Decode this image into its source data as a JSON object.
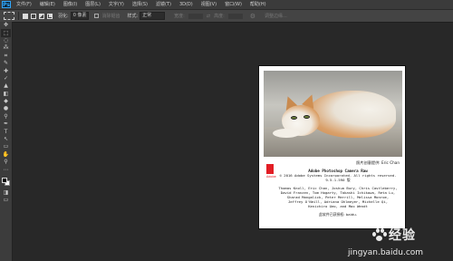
{
  "app": {
    "logo": "Ps"
  },
  "menu": [
    "文件(F)",
    "编辑(E)",
    "图像(I)",
    "图层(L)",
    "文字(Y)",
    "选择(S)",
    "滤镜(T)",
    "3D(D)",
    "视图(V)",
    "窗口(W)",
    "帮助(H)"
  ],
  "options": {
    "feather_label": "羽化:",
    "feather_value": "0 像素",
    "antialias_label": "消除锯齿",
    "style_label": "样式:",
    "style_value": "正常",
    "width_label": "宽度:",
    "height_label": "高度:",
    "refine_edge": "调整边缘..."
  },
  "tools": [
    "✥",
    "⬚",
    "◌",
    "⁂",
    "⌗",
    "✎",
    "✚",
    "✓",
    "▲",
    "◧",
    "◆",
    "●",
    "⚲",
    "✒",
    "T",
    "↖",
    "▭",
    "✋",
    "⚲",
    "⋯"
  ],
  "about": {
    "credit": "照片创意提供: Eric Chan",
    "adobe": "Adobe",
    "product": "Adobe Photoshop Camera Raw",
    "copyright": "© 2016 Adobe Systems Incorporated. All rights reserved.",
    "version": "9.5.1.590 版",
    "credits_lines": [
      "Thomas Knoll, Eric Chan, Joshua Bury, Chris Castleberry,",
      "David Franzen, Tom Hogarty, Takashi Ichikawa, Reta Lu,",
      "Sharad Mangalick, Peter Merrill, Melissa Monroe,",
      "Jeffrey O'Neill, Adriana Ohlmeyer, Michelle Qi,",
      "Kenichiro Ueo, and Max Wendt"
    ],
    "cn_credit": "此软件已获授权: baidu."
  },
  "watermark": {
    "text": "经验",
    "url": "jingyan.baidu.com"
  },
  "colors": {
    "canvas": "#282828",
    "menubar": "#3b3b3b",
    "ps_blue": "#31a8ff",
    "adobe_red": "#e21e25"
  }
}
